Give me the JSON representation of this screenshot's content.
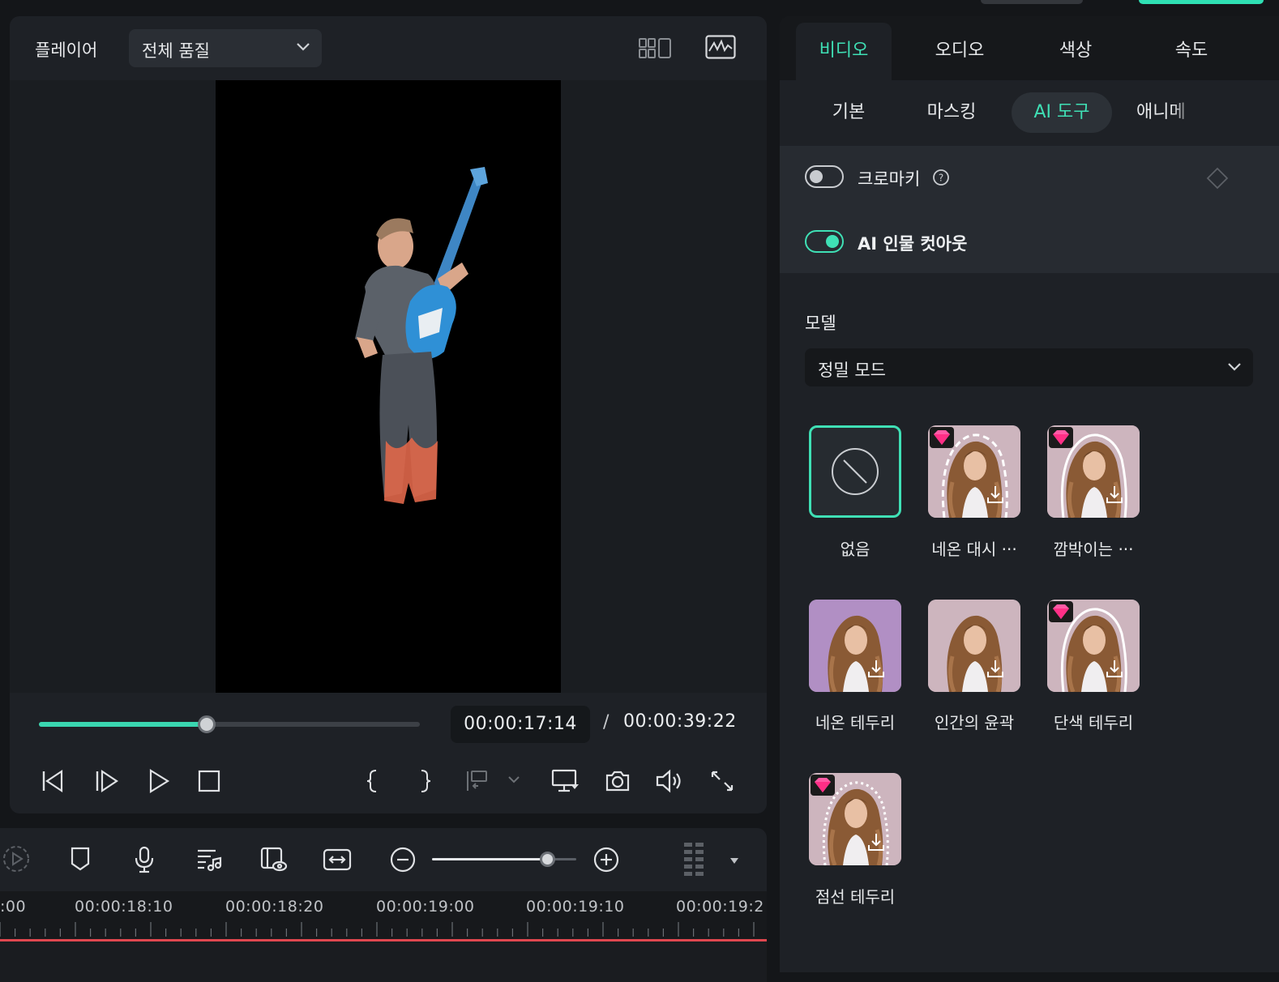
{
  "player": {
    "title": "플레이어",
    "quality": "전체 품질",
    "current_time": "00:00:17:14",
    "separator": "/",
    "total_time": "00:00:39:22",
    "progress_fraction": 0.44
  },
  "timeline": {
    "zoom_fraction": 0.8,
    "ruler_labels": [
      ":00",
      "00:00:18:10",
      "00:00:18:20",
      "00:00:19:00",
      "00:00:19:10",
      "00:00:19:2"
    ]
  },
  "panel": {
    "tabs": [
      {
        "label": "비디오",
        "active": true
      },
      {
        "label": "오디오",
        "active": false
      },
      {
        "label": "색상",
        "active": false
      },
      {
        "label": "속도",
        "active": false
      }
    ],
    "subtabs": [
      {
        "label": "기본",
        "active": false
      },
      {
        "label": "마스킹",
        "active": false
      },
      {
        "label": "AI 도구",
        "active": true
      },
      {
        "label": "애니메",
        "active": false
      }
    ],
    "chroma_key": {
      "label": "크로마키",
      "enabled": false
    },
    "ai_cutout": {
      "label": "AI 인물 컷아웃",
      "enabled": true
    },
    "model": {
      "label": "모델",
      "value": "정밀 모드"
    },
    "effects": [
      {
        "label": "없음",
        "premium": false,
        "selected": true
      },
      {
        "label": "네온 대시 ···",
        "premium": true
      },
      {
        "label": "깜박이는 ···",
        "premium": true
      },
      {
        "label": "네온 테두리",
        "premium": false
      },
      {
        "label": "인간의 윤곽",
        "premium": false
      },
      {
        "label": "단색 테두리",
        "premium": true
      },
      {
        "label": "점선 테두리",
        "premium": true
      }
    ]
  },
  "colors": {
    "accent": "#3fe0b5",
    "playhead": "#e0474f",
    "background": "#141619",
    "panel": "#1e2126"
  }
}
